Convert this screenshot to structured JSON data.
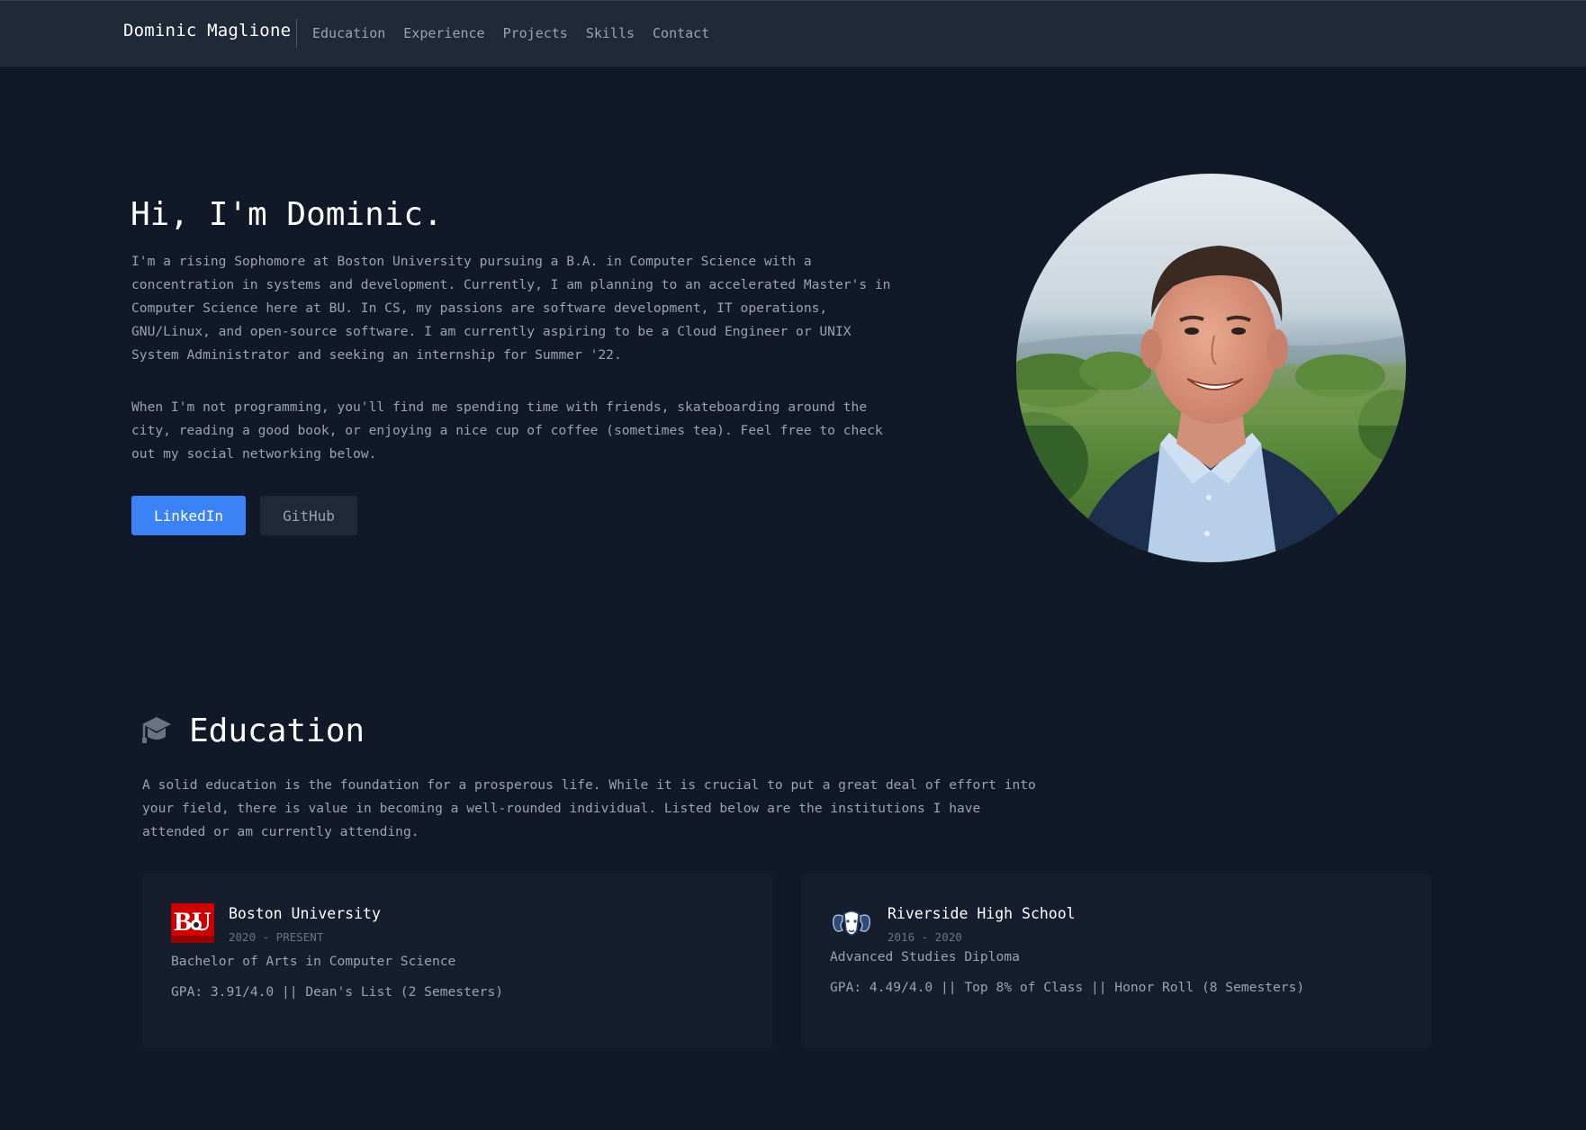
{
  "nav": {
    "brand": "Dominic Maglione",
    "links": [
      "Education",
      "Experience",
      "Projects",
      "Skills",
      "Contact"
    ]
  },
  "hero": {
    "title": "Hi, I'm Dominic.",
    "paragraph1": "I'm a rising Sophomore at Boston University pursuing a B.A. in Computer Science with a concentration in systems and development. Currently, I am planning to an accelerated Master's in Computer Science here at BU. In CS, my passions are software development, IT operations, GNU/Linux, and open-source software. I am currently aspiring to be a Cloud Engineer or UNIX System Administrator and seeking an internship for Summer '22.",
    "paragraph2": "When I'm not programming, you'll find me spending time with friends, skateboarding around the city, reading a good book, or enjoying a nice cup of coffee (sometimes tea). Feel free to check out my social networking below.",
    "buttons": {
      "linkedin": "LinkedIn",
      "github": "GitHub"
    }
  },
  "education": {
    "icon": "graduation-cap-icon",
    "title": "Education",
    "description": "A solid education is the foundation for a prosperous life. While it is crucial to put a great deal of effort into your field, there is value in becoming a well-rounded individual. Listed below are the institutions I have attended or am currently attending.",
    "schools": [
      {
        "logo": "boston-university-logo",
        "logo_text": "BU",
        "name": "Boston University",
        "years": "2020 - PRESENT",
        "degree": "Bachelor of Arts in Computer Science",
        "gpa": "GPA: 3.91/4.0 || Dean's List (2 Semesters)"
      },
      {
        "logo": "riverside-ram-logo",
        "name": "Riverside High School",
        "years": "2016 - 2020",
        "degree": "Advanced Studies Diploma",
        "gpa": "GPA: 4.49/4.0 || Top 8% of Class || Honor Roll (8 Semesters)"
      }
    ]
  },
  "colors": {
    "background": "#111827",
    "nav_background": "#1f2937",
    "card_background": "#161e2e",
    "accent": "#3b82f6",
    "bu_red": "#cc0000"
  }
}
